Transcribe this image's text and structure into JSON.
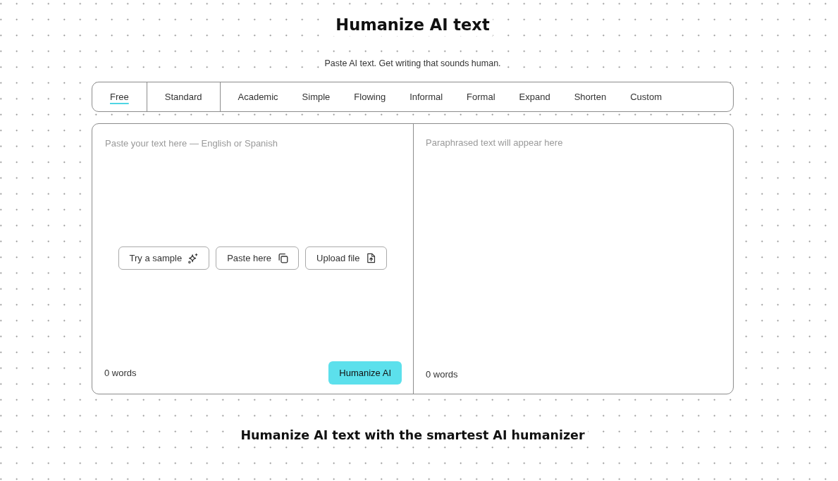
{
  "header": {
    "title": "Humanize AI text",
    "subtitle": "Paste AI text. Get writing that sounds human."
  },
  "mode_groups": [
    {
      "modes": [
        {
          "label": "Free",
          "selected": true
        }
      ]
    },
    {
      "modes": [
        {
          "label": "Standard",
          "selected": false
        }
      ]
    },
    {
      "modes": [
        {
          "label": "Academic",
          "selected": false
        },
        {
          "label": "Simple",
          "selected": false
        },
        {
          "label": "Flowing",
          "selected": false
        },
        {
          "label": "Informal",
          "selected": false
        },
        {
          "label": "Formal",
          "selected": false
        },
        {
          "label": "Expand",
          "selected": false
        },
        {
          "label": "Shorten",
          "selected": false
        },
        {
          "label": "Custom",
          "selected": false
        }
      ]
    }
  ],
  "input": {
    "placeholder": "Paste your text here — English or Spanish",
    "actions": [
      "Try a sample",
      "Paste here",
      "Upload file"
    ],
    "word_count": "0 words",
    "submit": "Humanize AI"
  },
  "output": {
    "empty_message": "Paraphrased text will appear here",
    "word_count": "0 words"
  },
  "section_title": "Humanize AI text with the smartest AI humanizer"
}
